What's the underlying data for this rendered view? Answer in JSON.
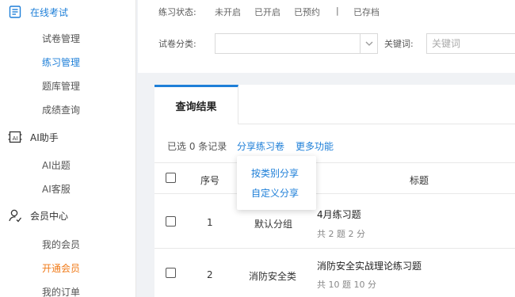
{
  "sidebar": {
    "groups": [
      {
        "label": "在线考试",
        "icon": "exam-icon",
        "items": [
          "试卷管理",
          "练习管理",
          "题库管理",
          "成绩查询"
        ]
      },
      {
        "label": "AI助手",
        "icon": "ai-icon",
        "items": [
          "AI出题",
          "AI客服"
        ]
      },
      {
        "label": "会员中心",
        "icon": "member-icon",
        "items": [
          "我的会员",
          "开通会员",
          "我的订单"
        ]
      }
    ]
  },
  "filter": {
    "status_label": "练习状态:",
    "statuses": [
      "未开启",
      "已开启",
      "已预约",
      "已存档"
    ],
    "separator": "|",
    "category_label": "试卷分类:",
    "category_value": "",
    "keyword_label": "关键词:",
    "keyword_placeholder": "关键词"
  },
  "results": {
    "tab_label": "查询结果",
    "selected_text": "已选 0 条记录",
    "actions": [
      "分享练习卷",
      "更多功能"
    ],
    "dropdown": [
      "按类别分享",
      "自定义分享"
    ],
    "columns": {
      "seq": "序号",
      "title": "标题"
    },
    "rows": [
      {
        "seq": "1",
        "category": "默认分组",
        "title": "4月练习题",
        "meta": "共 2 题 2 分"
      },
      {
        "seq": "2",
        "category": "消防安全类",
        "title": "消防安全实战理论练习题",
        "meta": "共 10 题 10 分"
      }
    ]
  },
  "colors": {
    "accent": "#1e7fd8",
    "highlight": "#f07a18"
  }
}
